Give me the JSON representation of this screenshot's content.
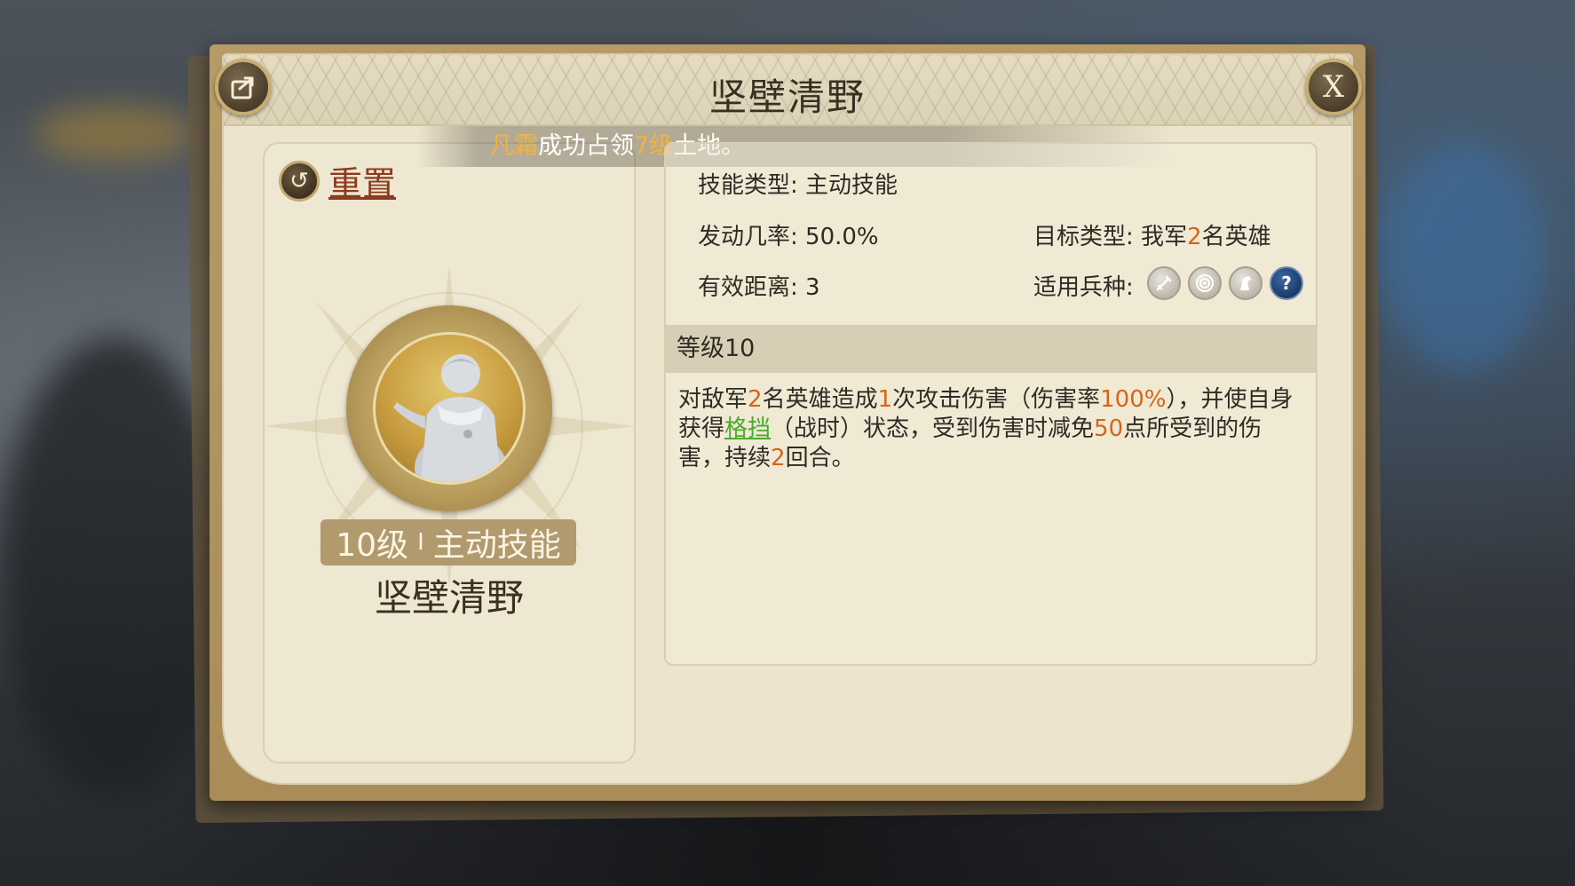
{
  "dialog": {
    "title": "坚壁清野",
    "close_label": "X"
  },
  "notice": {
    "player": "凡霜",
    "text1": "成功占领",
    "level": "7级",
    "text2": "土地。"
  },
  "left": {
    "reset_label": "重置",
    "level_label": "10级",
    "separator": "I",
    "skill_type_tag": "主动技能",
    "skill_name": "坚壁清野"
  },
  "info": {
    "skill_type_label": "技能类型:",
    "skill_type_value": "主动技能",
    "trigger_rate_label": "发动几率:",
    "trigger_rate_value": "50.0%",
    "target_type_label": "目标类型:",
    "target_pre": "我军",
    "target_num": "2",
    "target_post": "名英雄",
    "range_label": "有效距离:",
    "range_value": "3",
    "troop_label": "适用兵种:",
    "troop_icons": [
      "sword-icon",
      "bow-target-icon",
      "cavalry-horse-icon",
      "question-icon"
    ]
  },
  "level_section": {
    "header": "等级10"
  },
  "description": {
    "p1": "对敌军",
    "n1": "2",
    "p2": "名英雄造成",
    "n2": "1",
    "p3": "次攻击伤害（伤害率",
    "n3": "100%",
    "p4": "），并使自身获得",
    "link": "格挡",
    "p5": "（战时）状态，受到伤害时减免",
    "n4": "50",
    "p6": "点所受到的伤害，持续",
    "n5": "2",
    "p7": "回合。"
  },
  "colors": {
    "accent": "#d5651a",
    "link_green": "#4bab2e",
    "reset_red": "#8b3c1c",
    "frame_gold": "#b79b66",
    "parchment": "#ece4cd"
  }
}
